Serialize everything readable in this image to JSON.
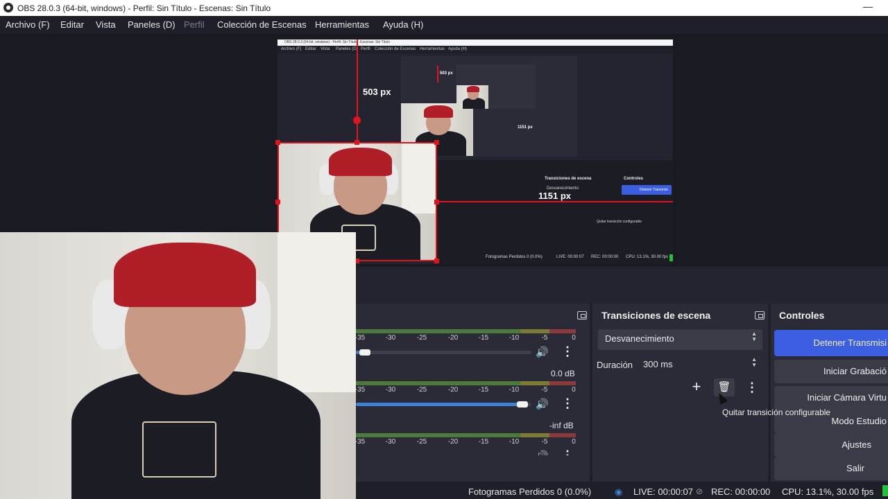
{
  "window": {
    "title": "OBS 28.0.3 (64-bit, windows) - Perfil: Sin Título - Escenas: Sin Título",
    "minimize_glyph": "—"
  },
  "menu": [
    "Archivo (F)",
    "Editar",
    "Vista",
    "Paneles (D)",
    "Perfil",
    "Colección de Escenas",
    "Herramientas",
    "Ayuda (H)"
  ],
  "menu_disabled": [
    "Perfil"
  ],
  "preview": {
    "nested_title": "OBS 28.0.3 (64-bit, windows) - Perfil: Sin Título - Escenas: Sin Título",
    "nested_menu": [
      "Archivo (F)",
      "Editar",
      "Vista",
      "Paneles (D)",
      "Perfil",
      "Colección de Escenas",
      "Herramientas",
      "Ayuda (H)"
    ],
    "nested_panels": {
      "transitions": "Transiciones de escena",
      "controls": "Controles",
      "transition_value": "Desvanecimiento",
      "stop_button": "Detener Transmisi",
      "tooltip": "Quitar transición configurable",
      "status": "Fotogramas Perdidos 0 (0.0%)",
      "live": "LIVE: 00:00:07",
      "rec": "REC: 00:00:00",
      "cpu": "CPU: 13.1%, 30.00 fps"
    },
    "guide_vertical_label": "503 px",
    "guide_horizontal_label": "1151 px",
    "nested_guide_v": "503 px",
    "nested_guide_h": "1151 px"
  },
  "mixer": {
    "scale": [
      "-35",
      "-30",
      "-25",
      "-20",
      "-15",
      "-10",
      "-5",
      "0"
    ],
    "channels": [
      {
        "db": "",
        "volume": 0.02,
        "muted_color": false
      },
      {
        "db": "0.0 dB",
        "volume": 0.98,
        "muted_color": false
      },
      {
        "db": "-inf dB",
        "volume": 0.0,
        "muted_color": false
      }
    ]
  },
  "transitions": {
    "title": "Transiciones de escena",
    "selected": "Desvanecimiento",
    "duration_label": "Duración",
    "duration_value": "300 ms",
    "add_icon": "+",
    "remove_icon": "🗑",
    "more_icon": "⋮",
    "tooltip": "Quitar transición configurable"
  },
  "controls": {
    "title": "Controles",
    "buttons": [
      "Detener Transmisi",
      "Iniciar Grabació",
      "Iniciar Cámara Virtu",
      "Modo Estudio",
      "Ajustes",
      "Salir"
    ]
  },
  "status": {
    "dropped": "Fotogramas Perdidos 0 (0.0%)",
    "live": "LIVE: 00:00:07",
    "rec": "REC: 00:00:00",
    "cpu": "CPU: 13.1%, 30.00 fps"
  },
  "colors": {
    "accent": "#3b5fe0",
    "guide": "#e0141b",
    "live": "#3c82d6",
    "cpu_ok": "#22c23a"
  }
}
